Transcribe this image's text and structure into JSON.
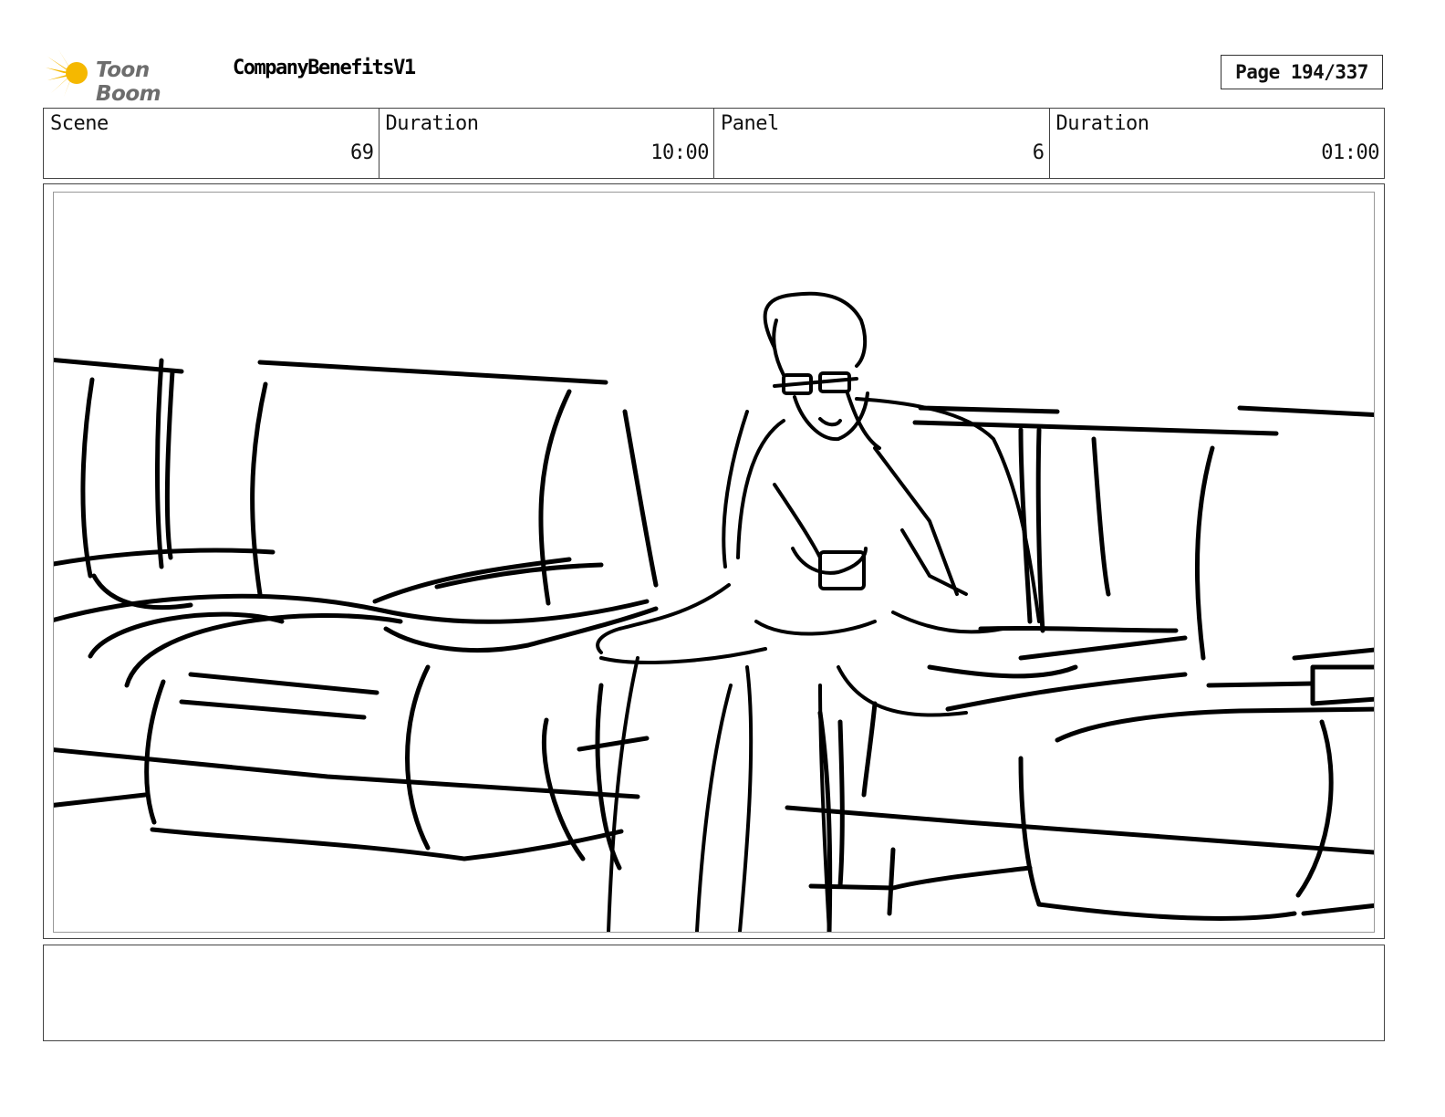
{
  "header": {
    "logo_text": "Toon Boom",
    "project_title": "CompanyBenefitsV1",
    "page_label": "Page 194/337"
  },
  "info": [
    {
      "label": "Scene",
      "value": "69"
    },
    {
      "label": "Duration",
      "value": "10:00"
    },
    {
      "label": "Panel",
      "value": "6"
    },
    {
      "label": "Duration",
      "value": "01:00"
    }
  ],
  "notes": {
    "text": ""
  },
  "colors": {
    "logo_accent": "#f5b800",
    "ink": "#000000",
    "border": "#444444"
  }
}
